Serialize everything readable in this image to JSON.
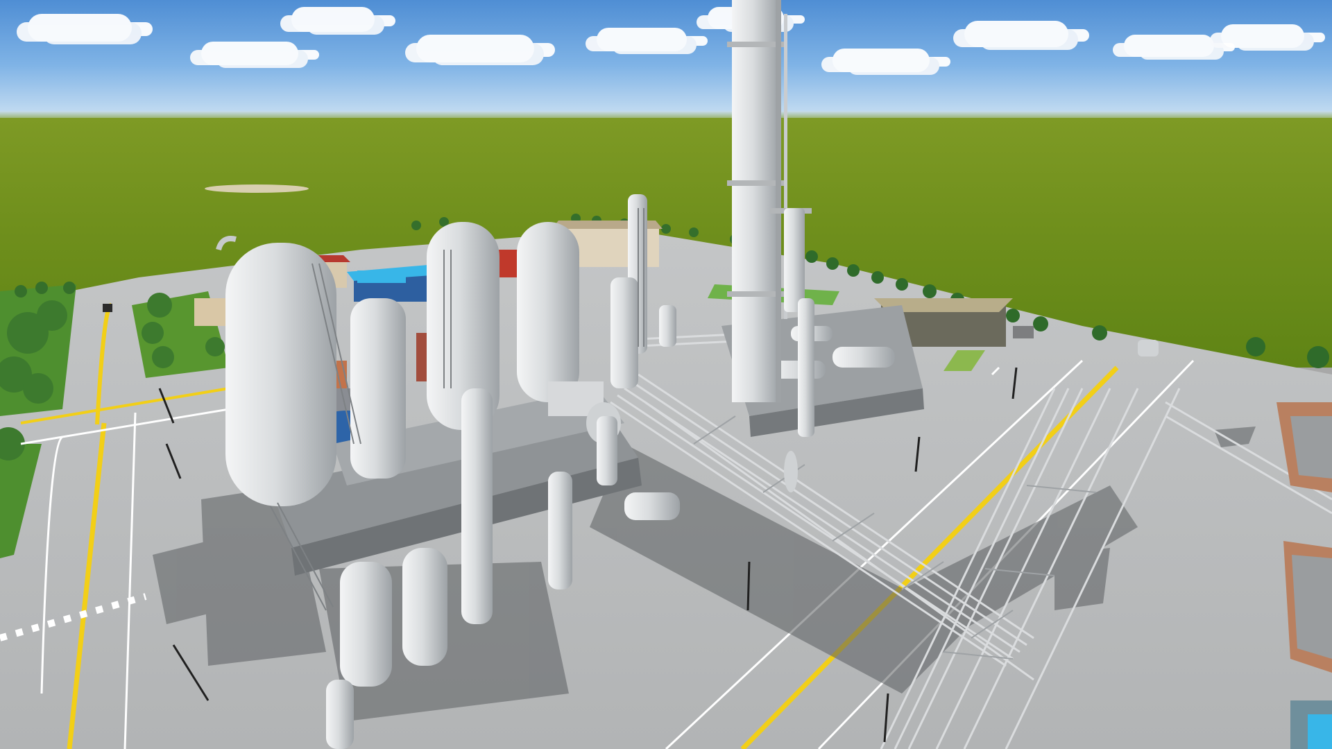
{
  "scene": {
    "kind": "3d-render",
    "subject": "refinery-plant",
    "palette": {
      "sky": "#6ea6df",
      "field": "#6f8f1c",
      "ground": "#b4b4b4",
      "equipment": "#cfd2d4",
      "lane_yellow": "#f2cf17",
      "lane_white": "#ffffff",
      "roof_red": "#c0392b",
      "pool_blue": "#38b6e8",
      "tree_green": "#2f6b2a"
    }
  }
}
